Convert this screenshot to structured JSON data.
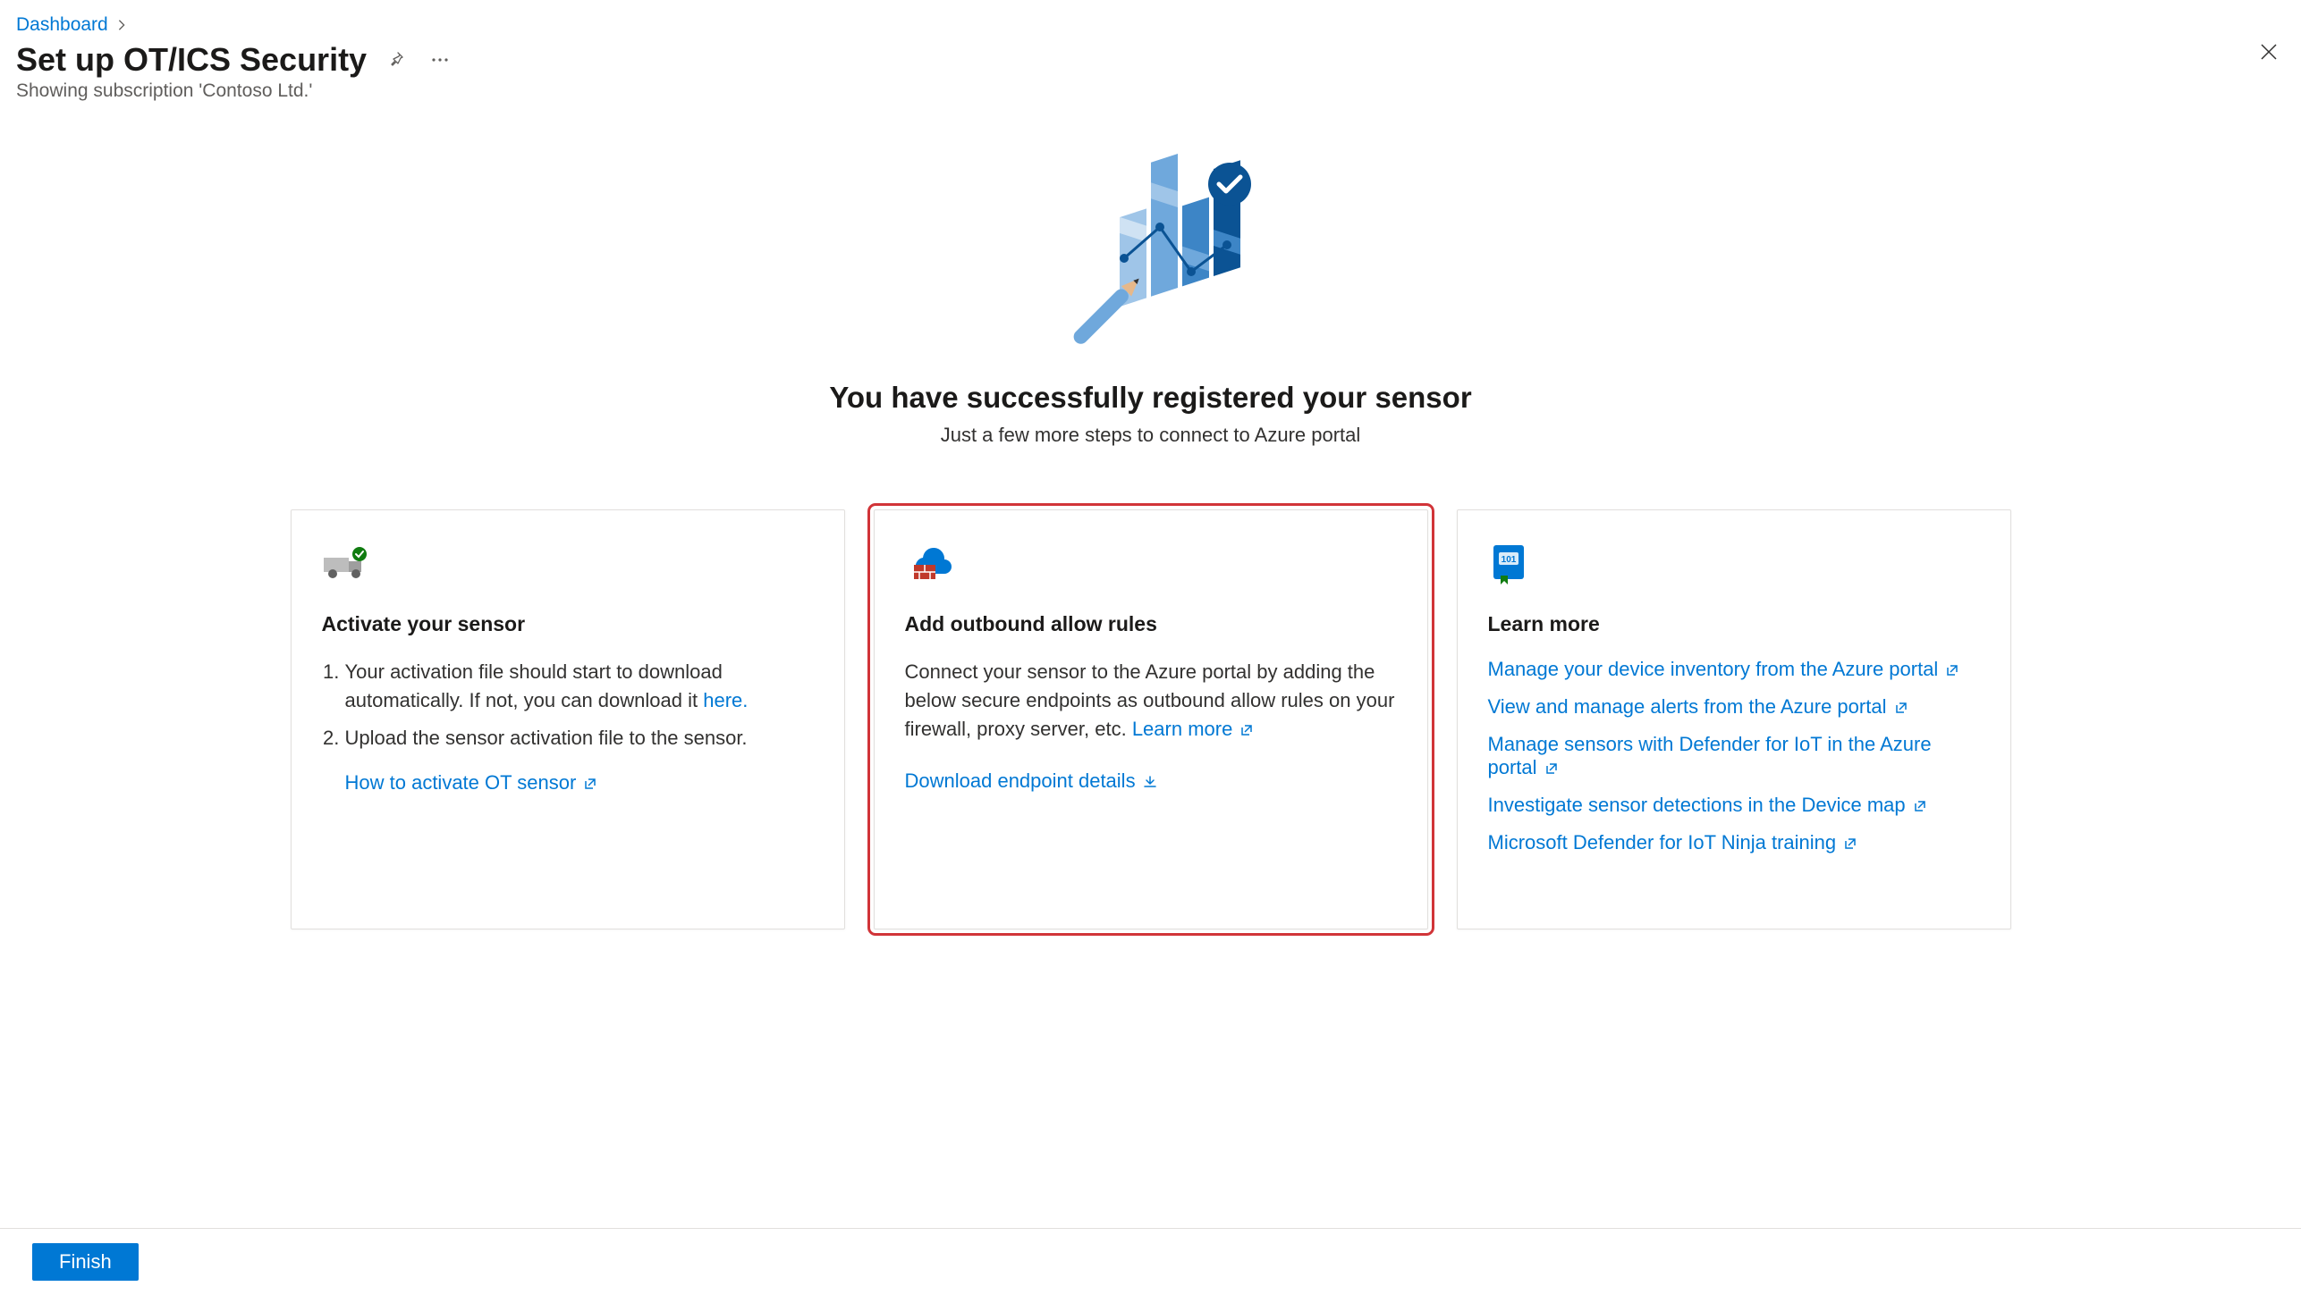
{
  "breadcrumb": {
    "item": "Dashboard"
  },
  "header": {
    "title": "Set up OT/ICS Security",
    "subtitle": "Showing subscription 'Contoso Ltd.'"
  },
  "hero": {
    "title": "You have successfully registered your sensor",
    "subtitle": "Just a few more steps to connect to Azure portal"
  },
  "cards": {
    "activate": {
      "title": "Activate your sensor",
      "step1_a": "Your activation file should start to download automatically. If not, you can download it",
      "step1_link": "here.",
      "step2": "Upload the sensor activation file to the sensor.",
      "howto_link": "How to activate OT sensor"
    },
    "outbound": {
      "title": "Add outbound allow rules",
      "body": "Connect your sensor to the Azure portal by adding the below secure endpoints as outbound allow rules on your firewall, proxy server, etc.",
      "learn_more": "Learn more",
      "download_link": "Download endpoint details"
    },
    "learn": {
      "title": "Learn more",
      "links": [
        "Manage your device inventory from the Azure portal",
        "View and manage alerts from the Azure portal",
        "Manage sensors with Defender for IoT in the Azure portal",
        "Investigate sensor detections in the Device map",
        "Microsoft Defender for IoT Ninja training"
      ]
    }
  },
  "footer": {
    "finish": "Finish"
  }
}
